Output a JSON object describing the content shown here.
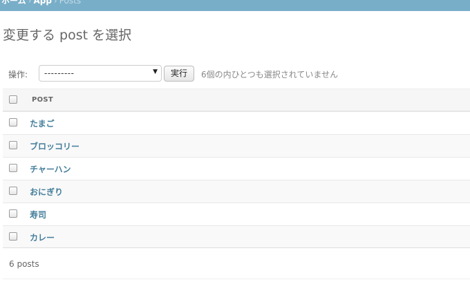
{
  "breadcrumbs": {
    "home": "ホーム",
    "separator_1": "›",
    "app": "App",
    "separator_2": "›",
    "current": "Posts"
  },
  "page_title": "変更する post を選択",
  "actions": {
    "label": "操作:",
    "select_value": "---------",
    "caret": "▼",
    "run_button": "実行",
    "selection_counter": "6個の内ひとつも選択されていません"
  },
  "table": {
    "column_header": "POST",
    "rows": [
      {
        "label": "たまご"
      },
      {
        "label": "ブロッコリー"
      },
      {
        "label": "チャーハン"
      },
      {
        "label": "おにぎり"
      },
      {
        "label": "寿司"
      },
      {
        "label": "カレー"
      }
    ]
  },
  "paginator": {
    "count": "6 posts"
  },
  "colors": {
    "header_bar": "#79aec8",
    "link": "#447e9b",
    "row_alt": "#f9f9f9"
  }
}
